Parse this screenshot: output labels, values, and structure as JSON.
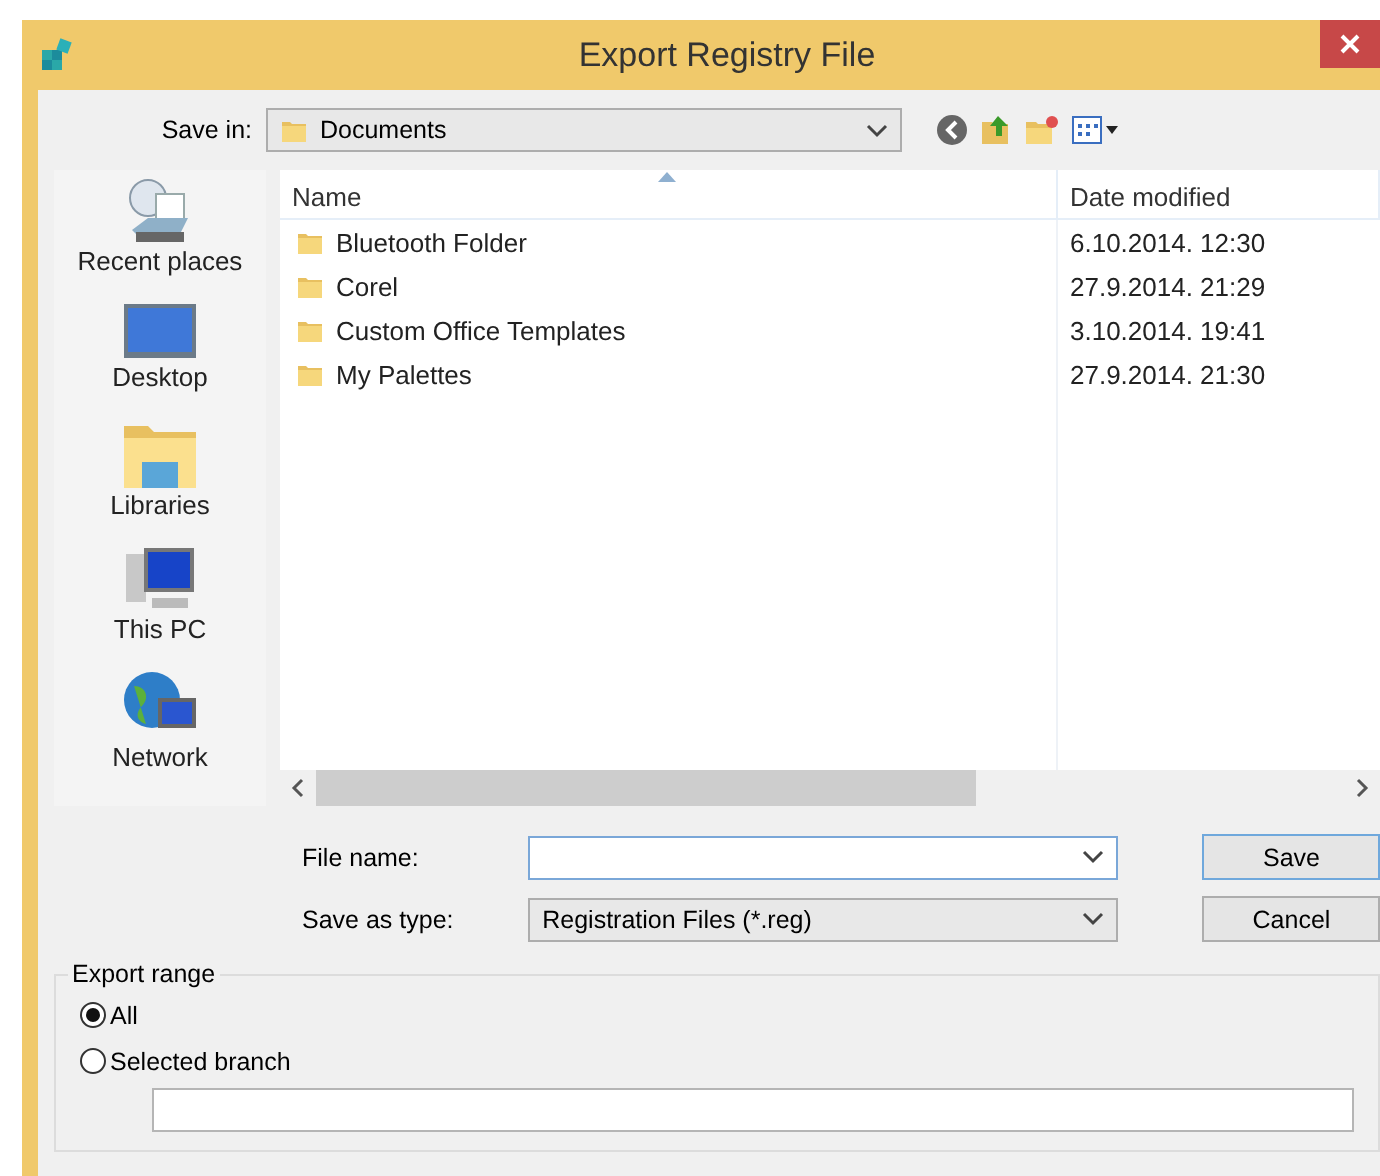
{
  "window": {
    "title": "Export Registry File"
  },
  "save_in": {
    "label": "Save in:",
    "value": "Documents"
  },
  "places": [
    {
      "label": "Recent places",
      "kind": "recent"
    },
    {
      "label": "Desktop",
      "kind": "desktop"
    },
    {
      "label": "Libraries",
      "kind": "libraries"
    },
    {
      "label": "This PC",
      "kind": "pc"
    },
    {
      "label": "Network",
      "kind": "network"
    }
  ],
  "file_list": {
    "columns": [
      "Name",
      "Date modified"
    ],
    "rows": [
      {
        "name": "Bluetooth Folder",
        "date": "6.10.2014. 12:30"
      },
      {
        "name": "Corel",
        "date": "27.9.2014. 21:29"
      },
      {
        "name": "Custom Office Templates",
        "date": "3.10.2014. 19:41"
      },
      {
        "name": "My Palettes",
        "date": "27.9.2014. 21:30"
      }
    ]
  },
  "file_name": {
    "label": "File name:"
  },
  "save_as_type": {
    "label": "Save as type:",
    "value": "Registration Files (*.reg)"
  },
  "buttons": [
    "Save",
    "Cancel"
  ],
  "export_range": {
    "title": "Export range",
    "options": [
      {
        "label": "All",
        "selected": true
      },
      {
        "label": "Selected branch",
        "selected": false
      }
    ]
  }
}
